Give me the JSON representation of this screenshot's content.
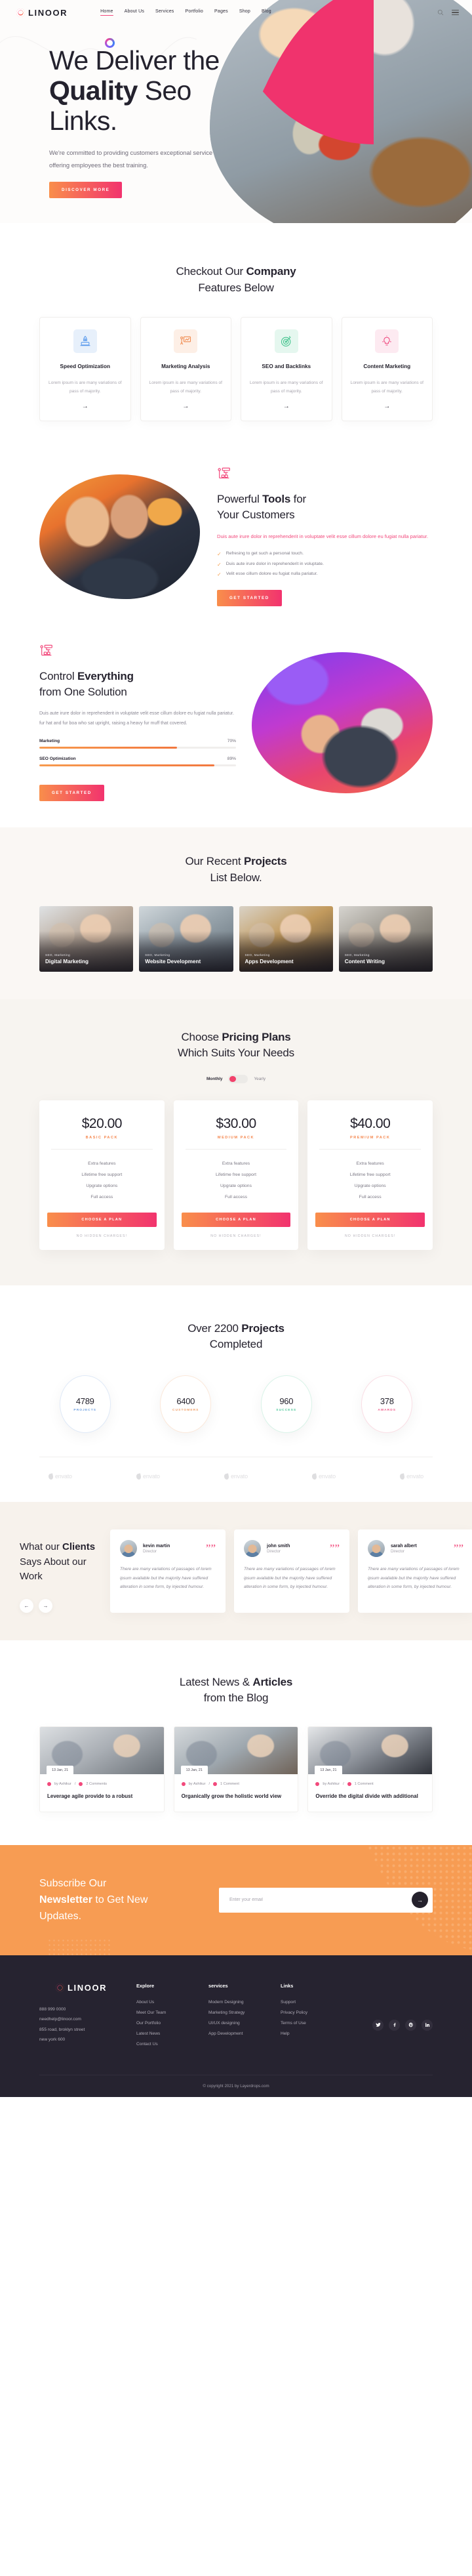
{
  "brand": {
    "name": "LINOOR"
  },
  "nav": {
    "items": [
      {
        "label": "Home",
        "active": true
      },
      {
        "label": "About Us",
        "active": false
      },
      {
        "label": "Services",
        "active": false
      },
      {
        "label": "Portfolio",
        "active": false
      },
      {
        "label": "Pages",
        "active": false
      },
      {
        "label": "Shop",
        "active": false
      },
      {
        "label": "Blog",
        "active": false
      }
    ],
    "search_icon": "search-icon",
    "menu_icon": "hamburger-icon"
  },
  "hero": {
    "title_line1": "We Deliver the",
    "title_bold": "Quality",
    "title_line2_rest": " Seo",
    "title_line3": "Links.",
    "subtitle": "We're committed to providing customers exceptional service offering employees the best training.",
    "cta": "DISCOVER MORE"
  },
  "features": {
    "title_pre": "Checkout Our ",
    "title_bold": "Company",
    "title_line2": "Features Below",
    "cards": [
      {
        "title": "Speed Optimization",
        "desc": "Lorem ipsum is are many variations of pass of majority.",
        "icon": "rocket-laptop-icon",
        "bg": "#e7f0fb",
        "color": "#5b9bed",
        "arrow": "→"
      },
      {
        "title": "Marketing Analysis",
        "desc": "Lorem ipsum is are many variations of pass of majority.",
        "icon": "presentation-chart-icon",
        "bg": "#fdefe6",
        "color": "#f08a4e",
        "arrow": "→"
      },
      {
        "title": "SEO and Backlinks",
        "desc": "Lorem ipsum is are many variations of pass of majority.",
        "icon": "target-arrow-icon",
        "bg": "#e5f7ef",
        "color": "#44c48e",
        "arrow": "→"
      },
      {
        "title": "Content Marketing",
        "desc": "Lorem ipsum is are many variations of pass of majority.",
        "icon": "lightbulb-idea-icon",
        "bg": "#fdeaf1",
        "color": "#ef4e82",
        "arrow": "→"
      }
    ]
  },
  "tools": {
    "icon": "org-chart-icon",
    "title_pre": "Powerful ",
    "title_bold": "Tools",
    "title_post": " for",
    "title_line2": "Your Customers",
    "lead": "Duis aute irure dolor in reprehenderit in voluptate velit esse cillum dolore eu fugiat nulla pariatur.",
    "list": [
      "Refresing to get such a personal touch.",
      "Duis aute irure dolor in reprehenderit in voluptate.",
      "Velit esse cillum dolore eu fugiat nulla pariatur."
    ],
    "cta": "GET STARTED"
  },
  "control": {
    "icon": "org-chart-icon",
    "title_pre": "Control ",
    "title_bold": "Everything",
    "title_line2": "from One Solution",
    "paragraph": "Duis aute irure dolor in reprehenderit in voluptate velit esse cillum dolore eu fugiat nulla pariatur. fur hat and fur boa who sat upright, raising a heavy fur muff that covered.",
    "bars": [
      {
        "label": "Marketing",
        "value": "70%",
        "pct": 70
      },
      {
        "label": "SEO Optimization",
        "value": "89%",
        "pct": 89
      }
    ],
    "cta": "GET STARTED"
  },
  "projects": {
    "title_pre": "Our Recent ",
    "title_bold": "Projects",
    "title_line2": "List Below.",
    "items": [
      {
        "category": "SEO, Marketing",
        "name": "Digital Marketing"
      },
      {
        "category": "SEO, Marketing",
        "name": "Website Development"
      },
      {
        "category": "SEO, Marketing",
        "name": "Apps Development"
      },
      {
        "category": "SEO, Marketing",
        "name": "Content Writing"
      }
    ]
  },
  "pricing": {
    "title_pre": "Choose ",
    "title_bold": "Pricing Plans",
    "title_line2": "Which Suits Your Needs",
    "toggle_monthly": "Monthly",
    "toggle_yearly": "Yearly",
    "plans": [
      {
        "price": "$20.00",
        "pack": "BASIC PACK",
        "features": [
          "Extra features",
          "Lifetime free support",
          "Upgrate options",
          "Full access"
        ],
        "cta": "CHOOSE A PLAN",
        "note": "NO HIDDEN CHARGES!"
      },
      {
        "price": "$30.00",
        "pack": "MEDIUM PACK",
        "features": [
          "Extra features",
          "Lifetime free support",
          "Upgrate options",
          "Full access"
        ],
        "cta": "CHOOSE A PLAN",
        "note": "NO HIDDEN CHARGES!"
      },
      {
        "price": "$40.00",
        "pack": "PREMIUM PACK",
        "features": [
          "Extra features",
          "Lifetime free support",
          "Upgrate options",
          "Full access"
        ],
        "cta": "CHOOSE A PLAN",
        "note": "NO HIDDEN CHARGES!"
      }
    ]
  },
  "counters": {
    "title_pre": "Over 2200 ",
    "title_bold": "Projects",
    "title_line2": "Completed",
    "items": [
      {
        "number": "4789",
        "label": "PROJECTS",
        "color": "#6d9fe0",
        "ring": "#dfe9f7"
      },
      {
        "number": "6400",
        "label": "CUSTOMERS",
        "color": "#f0a06a",
        "ring": "#fbe8da"
      },
      {
        "number": "960",
        "label": "SUCCESS",
        "color": "#4ec79a",
        "ring": "#d9f3e8"
      },
      {
        "number": "378",
        "label": "AWARDS",
        "color": "#ee5f8c",
        "ring": "#fade5"
      }
    ],
    "brands": [
      "envato",
      "envato",
      "envato",
      "envato",
      "envato"
    ]
  },
  "testimonials": {
    "title_pre": "What our ",
    "title_bold": "Clients",
    "title_line2": "Says About our",
    "title_line3": "Work",
    "prev_icon": "arrow-left-icon",
    "next_icon": "arrow-right-icon",
    "items": [
      {
        "name": "kevin martin",
        "role": "Director",
        "text": "There are many variations of passages of lorem ipsum available but the majority have suffered alteration in some form, by injected humour."
      },
      {
        "name": "john smith",
        "role": "Director",
        "text": "There are many variations of passages of lorem ipsum available but the majority have suffered alteration in some form, by injected humour."
      },
      {
        "name": "sarah albert",
        "role": "Director",
        "text": "There are many variations of passages of lorem ipsum available but the majority have suffered alteration in some form, by injected humour."
      }
    ]
  },
  "blog": {
    "title_pre": "Latest News & ",
    "title_bold": "Articles",
    "title_line2": "from the Blog",
    "posts": [
      {
        "date": "13 Jan, 21",
        "author": "by Ashikur",
        "comments": "2 Comments",
        "title": "Leverage agile provide to a robust"
      },
      {
        "date": "13 Jan, 21",
        "author": "by Ashikur",
        "comments": "1 Comment",
        "title": "Organically grow the holistic world view"
      },
      {
        "date": "13 Jan, 21",
        "author": "by Ashikur",
        "comments": "1 Comment",
        "title": "Override the digital divide with additional"
      }
    ]
  },
  "newsletter": {
    "line1": "Subscribe Our",
    "bold": "Newsletter",
    "line2_rest": " to Get New",
    "line3": "Updates.",
    "placeholder": "Enter your email",
    "submit_icon": "arrow-right-icon"
  },
  "footer": {
    "brand": "LINOOR",
    "contact": [
      "888 999 0000",
      "needhelp@linoor.com",
      "855 road, broklyn street",
      "new york 600"
    ],
    "columns": [
      {
        "heading": "Explore",
        "links": [
          "About Us",
          "Meet Our Team",
          "Our Portfolio",
          "Latest News",
          "Contact Us"
        ]
      },
      {
        "heading": "services",
        "links": [
          "Modern Designing",
          "Marketing Strategy",
          "UI/UX designing",
          "App Development"
        ]
      },
      {
        "heading": "Links",
        "links": [
          "Support",
          "Privacy Policy",
          "Terms of Use",
          "Help"
        ]
      }
    ],
    "social": [
      {
        "name": "twitter-icon",
        "glyph": "❖"
      },
      {
        "name": "facebook-icon",
        "glyph": "f"
      },
      {
        "name": "pinterest-icon",
        "glyph": "р"
      },
      {
        "name": "linkedin-icon",
        "glyph": "in"
      }
    ],
    "copyright": "© copyright 2021 by Layerdrops.com"
  },
  "colors": {
    "accent_pink": "#f2497c",
    "accent_orange": "#f79c53",
    "dark": "#262330"
  }
}
